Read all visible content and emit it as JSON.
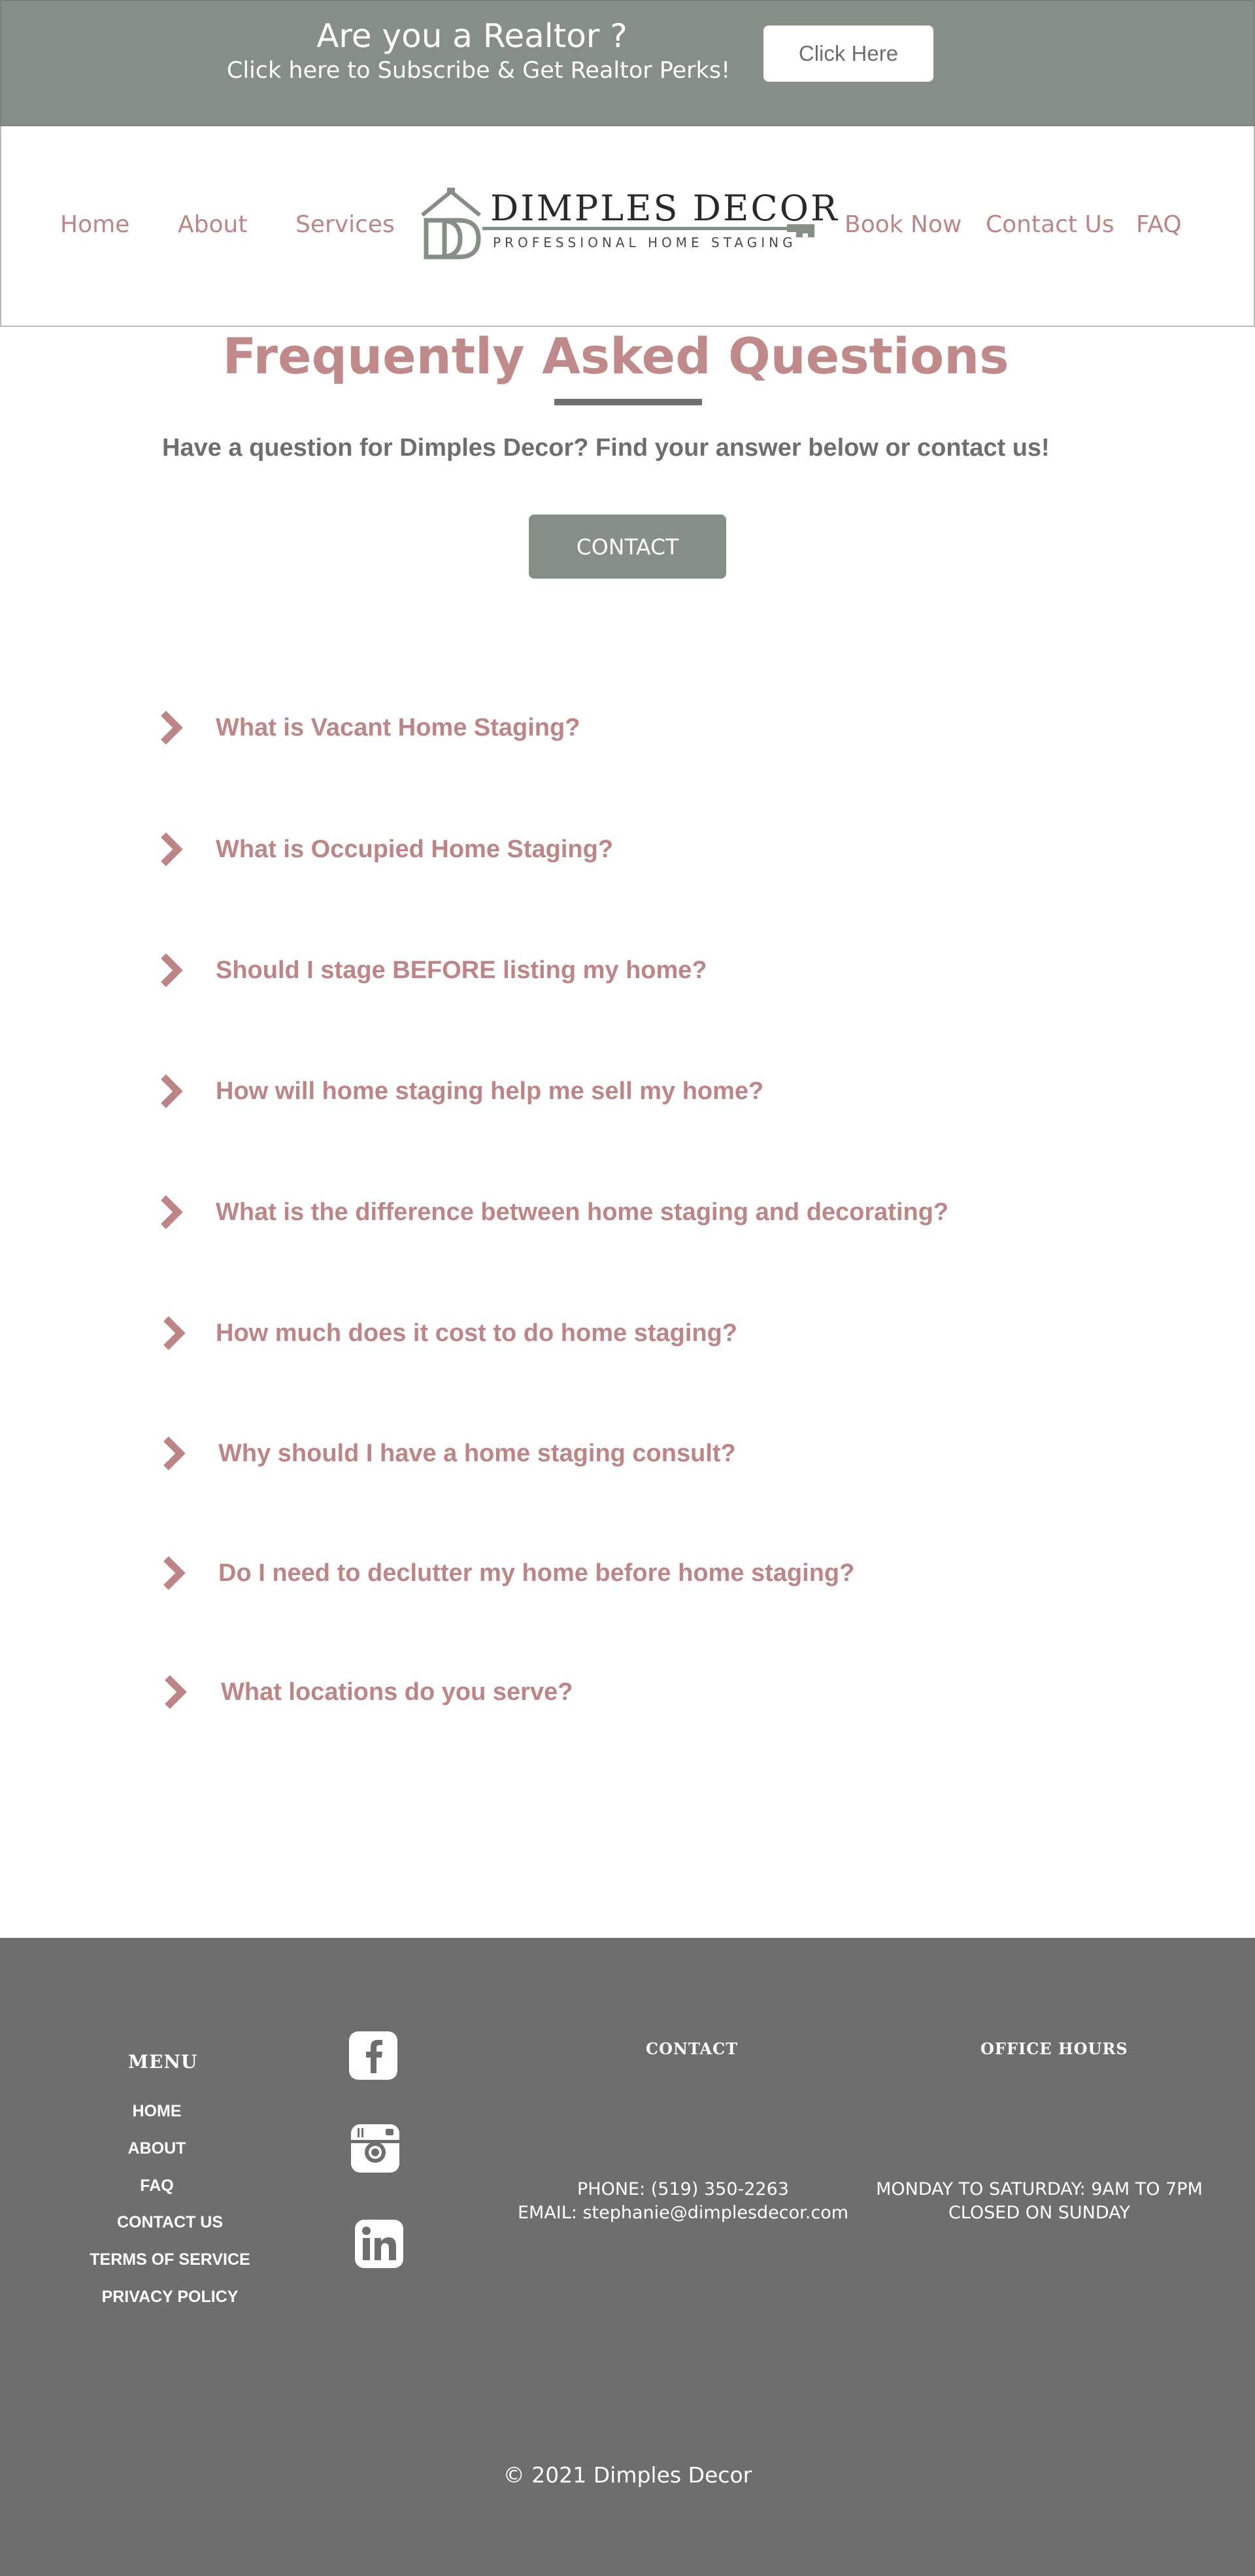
{
  "banner": {
    "heading": "Are you a Realtor ?",
    "subheading": "Click here to Subscribe & Get Realtor Perks!",
    "button_label": "Click Here"
  },
  "nav": {
    "left": [
      "Home",
      "About",
      "Services"
    ],
    "right": [
      "Book Now",
      "Contact Us",
      "FAQ"
    ]
  },
  "logo": {
    "name": "DIMPLES DECOR",
    "tagline": "PROFESSIONAL HOME STAGING"
  },
  "faq": {
    "title": "Frequently Asked Questions",
    "intro": "Have a question for Dimples Decor? Find your answer below or contact us!",
    "contact_button": "CONTACT",
    "questions": [
      "What is Vacant Home Staging?",
      "What is Occupied Home Staging?",
      "Should I stage BEFORE listing my home?",
      "How will home staging help me sell my home?",
      "What is the difference between home staging and decorating?",
      "How much does it cost to do home staging?",
      "Why should I have a home staging consult?",
      "Do I need to declutter my home before home staging?",
      "What locations do you serve?"
    ]
  },
  "footer": {
    "menu_heading": "MENU",
    "menu_items": [
      "HOME",
      "ABOUT",
      "FAQ",
      "CONTACT US",
      "TERMS OF SERVICE",
      "PRIVACY POLICY"
    ],
    "social_icons": [
      "facebook-icon",
      "instagram-icon",
      "linkedin-icon"
    ],
    "contact_heading": "CONTACT",
    "phone": "PHONE: (519) 350-2263",
    "email": "EMAIL: stephanie@dimplesdecor.com",
    "hours_heading": "OFFICE HOURS",
    "hours_line1": "MONDAY TO SATURDAY: 9AM TO 7PM",
    "hours_line2": "CLOSED ON SUNDAY",
    "copyright": "© 2021 Dimples Decor"
  },
  "colors": {
    "accent_pink": "#bd8585",
    "sage_green": "#858f85",
    "footer_gray": "#6e6e6e",
    "rule_gray": "#707070"
  }
}
